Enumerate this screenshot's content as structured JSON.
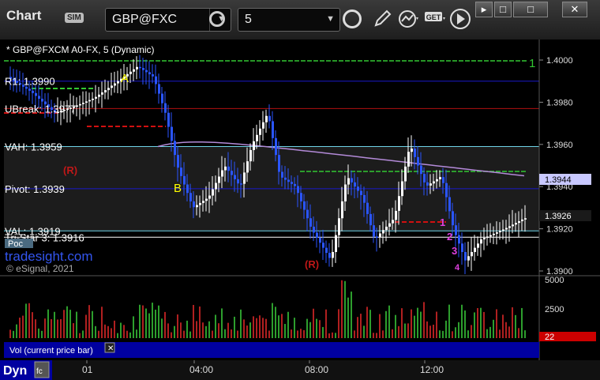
{
  "toolbar": {
    "title": "Chart",
    "sim_badge": "SIM",
    "symbol": "GBP@FXC",
    "interval": "5",
    "window_buttons": [
      "▸",
      "□",
      "□",
      "✕"
    ]
  },
  "icons": [
    "cursor-arrow-icon",
    "gear-icon",
    "clock-icon",
    "pencil-icon",
    "studies-icon",
    "get-icon",
    "play-icon"
  ],
  "chart_header": "* GBP@FXCM A0-FX, 5 (Dynamic)",
  "levels": [
    {
      "label": "R1: 1.3990",
      "value": 1.399,
      "color": "#1818c8"
    },
    {
      "label": "UBreak: 1.3977",
      "value": 1.3977,
      "color": "#b01010"
    },
    {
      "label": "VAH: 1.3959",
      "value": 1.3959,
      "color": "#6fd3e8"
    },
    {
      "label": "Pivot: 1.3939",
      "value": 1.3939,
      "color": "#1818c8"
    },
    {
      "label": "VAL: 1.3919",
      "value": 1.3919,
      "color": "#6fd3e8"
    },
    {
      "label": "Tri-Star 3: 1.3916",
      "value": 1.3916,
      "color": "#ffffff"
    }
  ],
  "price_axis": {
    "ticks": [
      "1.4000",
      "1.3980",
      "1.3960",
      "1.3940",
      "1.3920",
      "1.3900"
    ],
    "last_price": "1.3926",
    "poc_price": "1.3944"
  },
  "volume_axis": {
    "ticks": [
      "5000",
      "2500"
    ],
    "current": "22"
  },
  "time_axis": {
    "labels": [
      "01",
      "04:00",
      "08:00",
      "12:00"
    ]
  },
  "markers": {
    "A": "A",
    "B": "B",
    "R": "(R)",
    "seq": [
      "1",
      "2",
      "3",
      "4"
    ],
    "one": "1"
  },
  "watermark": "tradesight.com",
  "copyright": "© eSignal, 2021",
  "poc_tag": "Poc",
  "volume_label": "Vol (current price bar)",
  "footer": {
    "dyn": "Dyn",
    "lock": "fc"
  },
  "colors": {
    "candle_up": "#ffffff",
    "candle_down": "#2a55ff",
    "vwap": "#b38ad8",
    "volume_up": "#2d9e2d",
    "volume_down": "#b02020",
    "green_level": "#32c832"
  }
}
